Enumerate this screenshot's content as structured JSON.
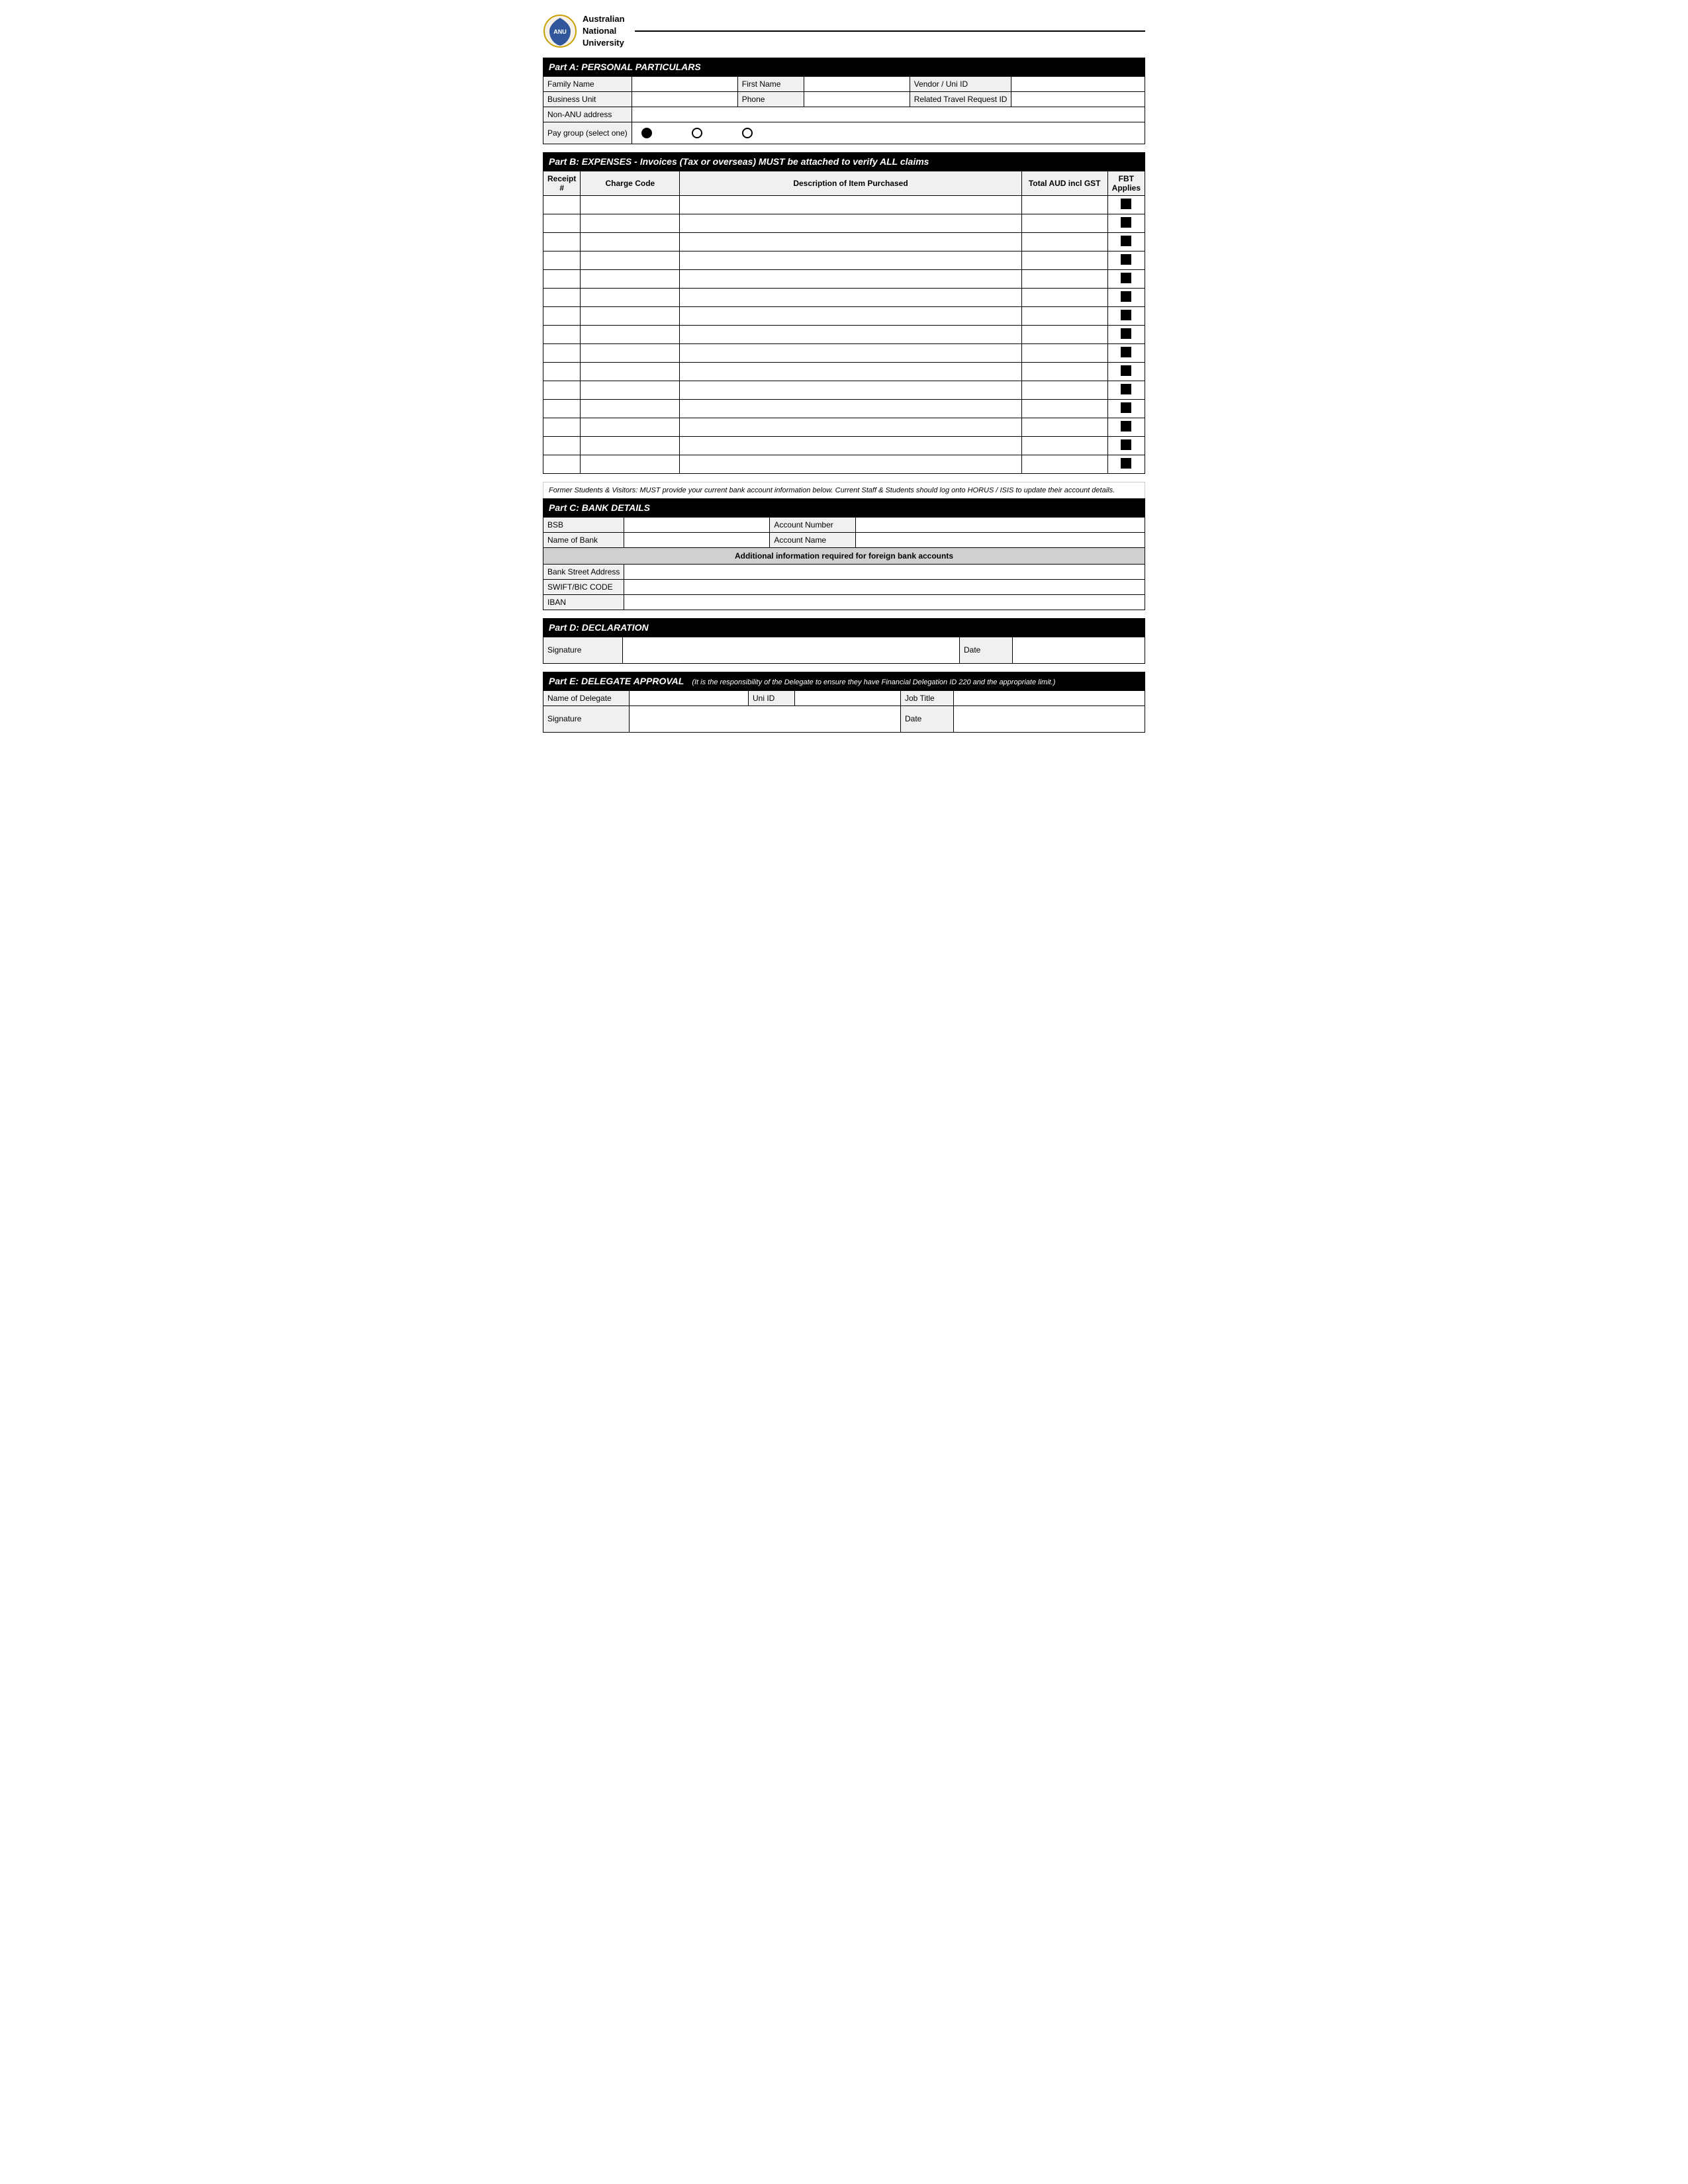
{
  "header": {
    "university_name": "Australian\nNational\nUniversity",
    "logo_alt": "ANU Logo"
  },
  "part_a": {
    "title": "Part A: PERSONAL PARTICULARS",
    "fields": {
      "family_name_label": "Family Name",
      "first_name_label": "First Name",
      "vendor_id_label": "Vendor / Uni ID",
      "business_unit_label": "Business Unit",
      "phone_label": "Phone",
      "travel_request_label": "Related Travel Request ID",
      "non_anu_label": "Non-ANU address",
      "pay_group_label": "Pay group (select one)"
    },
    "radio_options": [
      "",
      "",
      ""
    ]
  },
  "part_b": {
    "title": "Part B: EXPENSES - Invoices (Tax or overseas) MUST be attached to verify ALL claims",
    "col_receipt": "Receipt\n#",
    "col_charge": "Charge Code",
    "col_description": "Description of Item Purchased",
    "col_total": "Total AUD incl GST",
    "col_fbt": "FBT\nApplies",
    "rows": 15
  },
  "notice": {
    "text": "Former Students & Visitors: MUST provide your current bank account information below. Current Staff & Students should log onto HORUS / ISIS to update their account details."
  },
  "part_c": {
    "title": "Part C: BANK DETAILS",
    "bsb_label": "BSB",
    "account_number_label": "Account Number",
    "name_of_bank_label": "Name of Bank",
    "account_name_label": "Account Name",
    "foreign_header": "Additional information required for foreign bank accounts",
    "bank_street_label": "Bank Street Address",
    "swift_label": "SWIFT/BIC CODE",
    "iban_label": "IBAN"
  },
  "part_d": {
    "title": "Part D: DECLARATION",
    "signature_label": "Signature",
    "date_label": "Date"
  },
  "part_e": {
    "title": "Part E: DELEGATE APPROVAL",
    "note": "(It is the responsibility of the Delegate to ensure they have Financial Delegation ID 220 and the appropriate limit.)",
    "name_label": "Name of Delegate",
    "uni_id_label": "Uni ID",
    "job_title_label": "Job Title",
    "signature_label": "Signature",
    "date_label": "Date"
  }
}
